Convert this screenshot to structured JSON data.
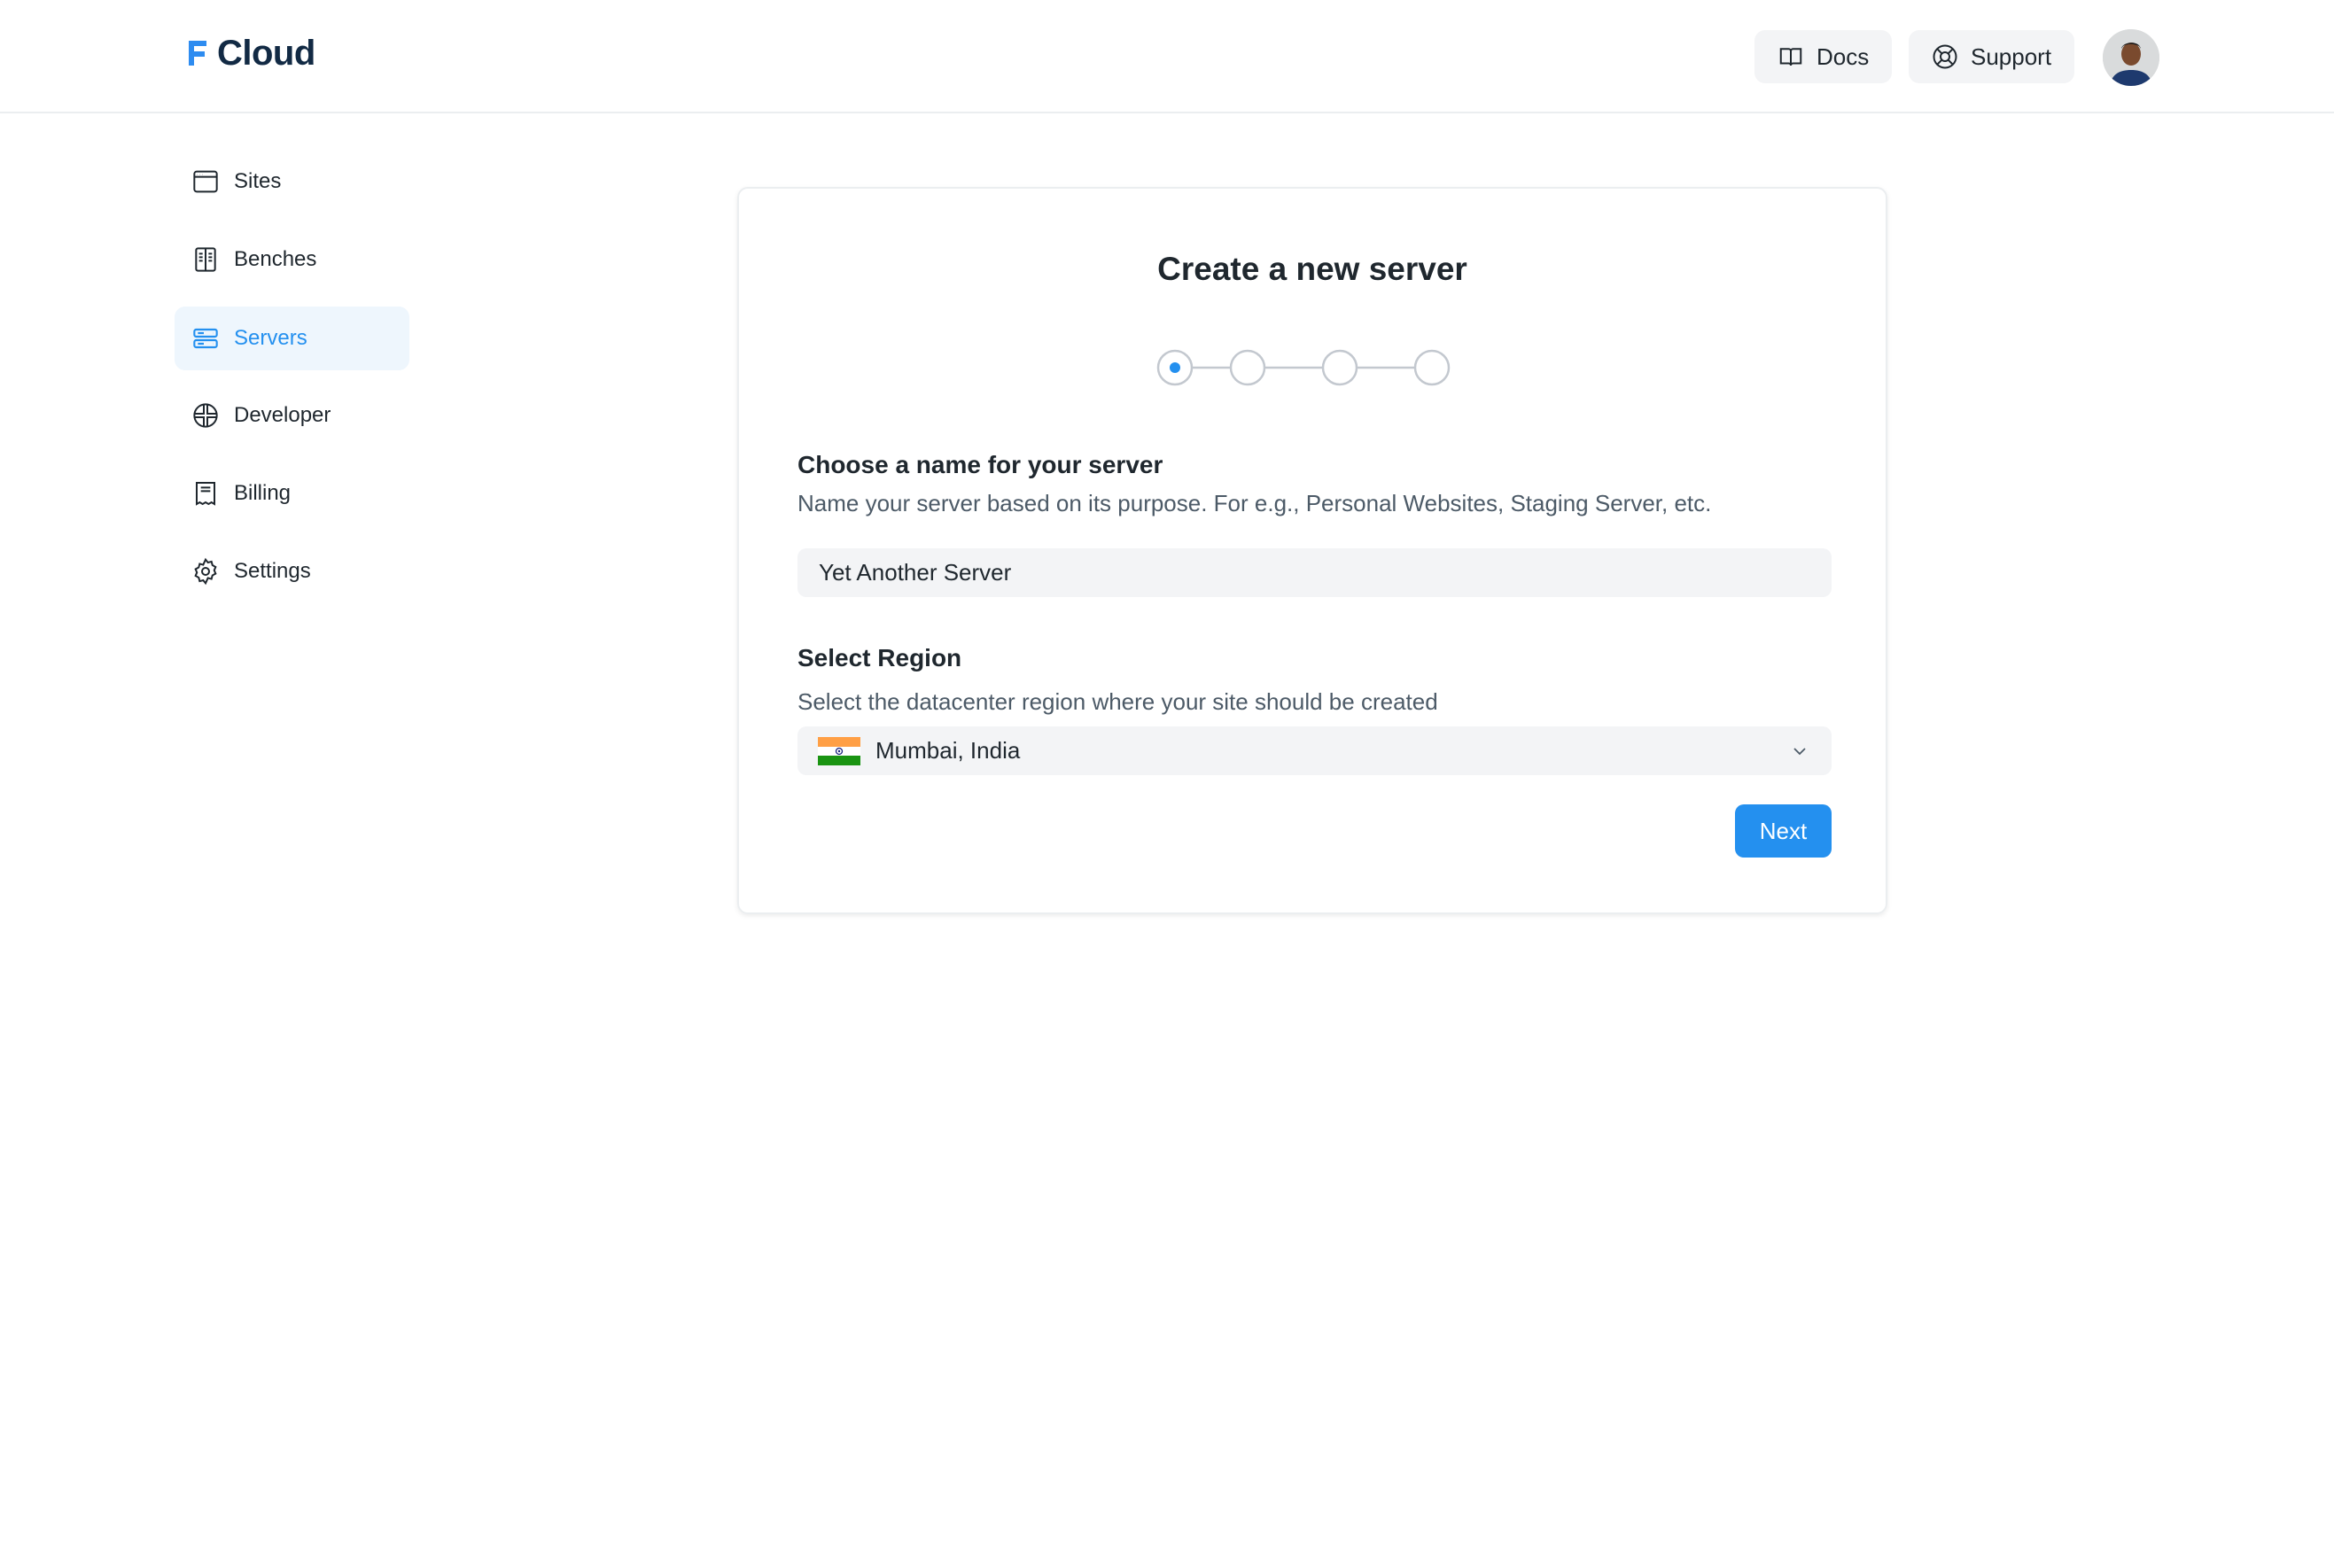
{
  "header": {
    "brand": "Cloud",
    "docs_label": "Docs",
    "support_label": "Support"
  },
  "sidebar": {
    "items": [
      {
        "label": "Sites",
        "icon": "browser-window-icon"
      },
      {
        "label": "Benches",
        "icon": "bench-icon"
      },
      {
        "label": "Servers",
        "icon": "server-icon",
        "active": true
      },
      {
        "label": "Developer",
        "icon": "developer-icon"
      },
      {
        "label": "Billing",
        "icon": "receipt-icon"
      },
      {
        "label": "Settings",
        "icon": "gear-icon"
      }
    ]
  },
  "main": {
    "title": "Create a new server",
    "steps": {
      "total": 4,
      "current": 1
    },
    "name_section": {
      "heading": "Choose a name for your server",
      "description": "Name your server based on its purpose. For e.g., Personal Websites, Staging Server, etc.",
      "value": "Yet Another Server"
    },
    "region_section": {
      "heading": "Select Region",
      "description": "Select the datacenter region where your site should be created",
      "selected": "Mumbai, India"
    },
    "next_label": "Next"
  },
  "colors": {
    "accent": "#2490ef",
    "brand_dark": "#122a44"
  }
}
